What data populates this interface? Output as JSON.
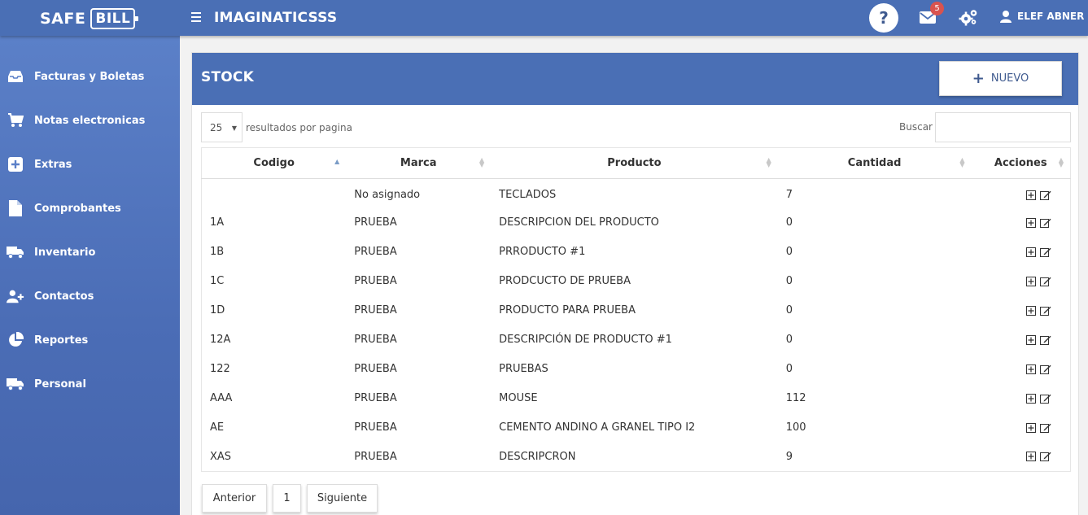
{
  "brand": {
    "part1": "SAFE",
    "part2": "BILL"
  },
  "header": {
    "company": "IMAGINATICSSS",
    "help": "?",
    "mail_count": "5",
    "user_name": "ELEF ABNER"
  },
  "sidebar": {
    "items": [
      {
        "label": "Facturas y Boletas",
        "icon": "inbox-icon"
      },
      {
        "label": "Notas electronicas",
        "icon": "cart-icon"
      },
      {
        "label": "Extras",
        "icon": "plus-square-icon"
      },
      {
        "label": "Comprobantes",
        "icon": "file-icon"
      },
      {
        "label": "Inventario",
        "icon": "truck-icon"
      },
      {
        "label": "Contactos",
        "icon": "user-plus-icon"
      },
      {
        "label": "Reportes",
        "icon": "pie-chart-icon"
      },
      {
        "label": "Personal",
        "icon": "truck-icon"
      }
    ]
  },
  "card": {
    "title": "STOCK",
    "new_label": "NUEVO"
  },
  "table_controls": {
    "page_size": "25",
    "page_size_label": "resultados por pagina",
    "search_label": "Buscar",
    "search_value": ""
  },
  "table": {
    "headers": [
      "Codigo",
      "Marca",
      "Producto",
      "Cantidad",
      "Acciones"
    ],
    "rows": [
      {
        "codigo": "",
        "marca": "No asignado",
        "producto": "TECLADOS",
        "cantidad": "7"
      },
      {
        "codigo": "1A",
        "marca": "PRUEBA",
        "producto": "DESCRIPCION DEL PRODUCTO",
        "cantidad": "0"
      },
      {
        "codigo": "1B",
        "marca": "PRUEBA",
        "producto": "PRRODUCTO #1",
        "cantidad": "0"
      },
      {
        "codigo": "1C",
        "marca": "PRUEBA",
        "producto": "PRODCUCTO DE PRUEBA",
        "cantidad": "0"
      },
      {
        "codigo": "1D",
        "marca": "PRUEBA",
        "producto": "PRODUCTO PARA PRUEBA",
        "cantidad": "0"
      },
      {
        "codigo": "12A",
        "marca": "PRUEBA",
        "producto": "DESCRIPCIÓN DE PRODUCTO #1",
        "cantidad": "0"
      },
      {
        "codigo": "122",
        "marca": "PRUEBA",
        "producto": "PRUEBAS",
        "cantidad": "0"
      },
      {
        "codigo": "AAA",
        "marca": "PRUEBA",
        "producto": "MOUSE",
        "cantidad": "112"
      },
      {
        "codigo": "AE",
        "marca": "PRUEBA",
        "producto": "CEMENTO ANDINO A GRANEL TIPO I2",
        "cantidad": "100"
      },
      {
        "codigo": "XAS",
        "marca": "PRUEBA",
        "producto": "DESCRIPCRON",
        "cantidad": "9"
      }
    ]
  },
  "pagination": {
    "prev": "Anterior",
    "page": "1",
    "next": "Siguiente"
  },
  "colors": {
    "primary": "#4a6fb5",
    "badge": "#d9534f",
    "sidebar_top": "#5b80c8"
  }
}
